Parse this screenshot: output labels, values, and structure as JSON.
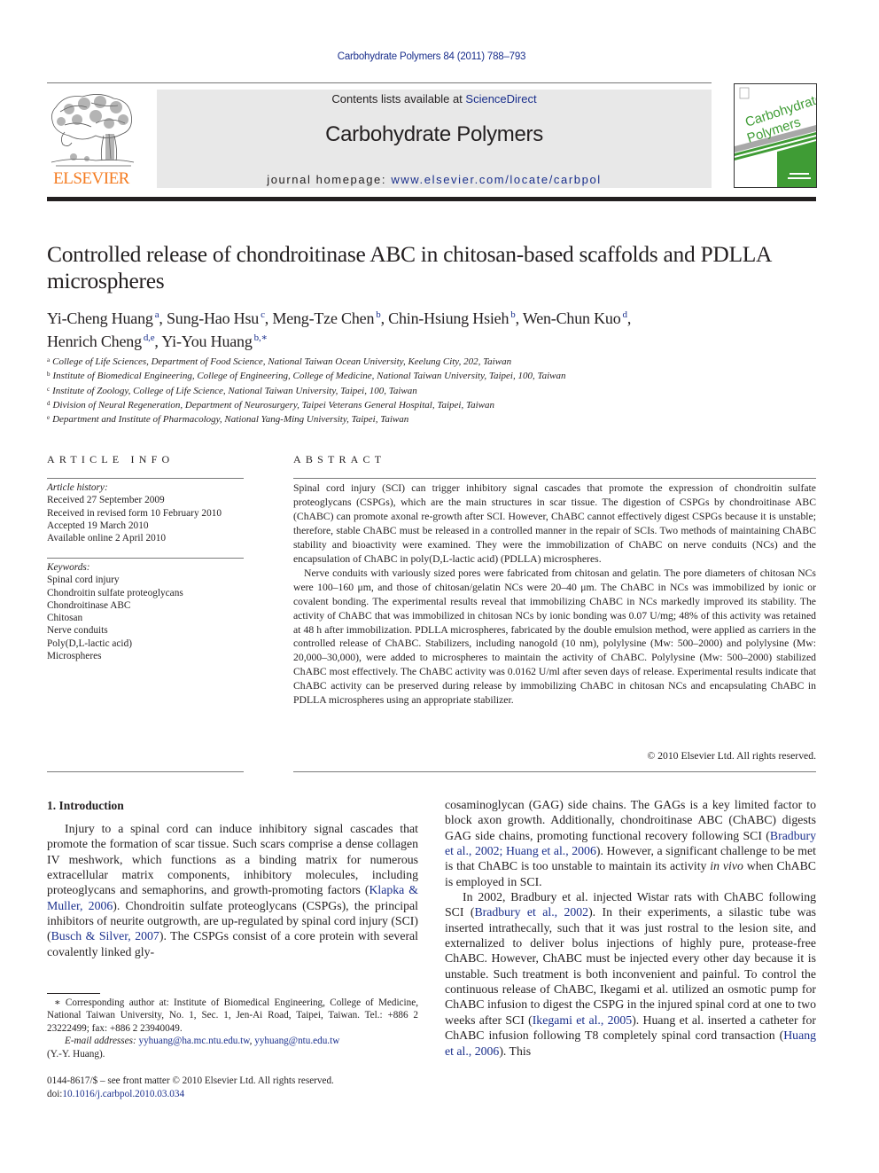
{
  "header": {
    "citation": "Carbohydrate Polymers 84 (2011) 788–793",
    "contents_prefix": "Contents lists available at ",
    "contents_link": "ScienceDirect",
    "journal_title": "Carbohydrate Polymers",
    "homepage_prefix": "journal homepage: ",
    "homepage_link": "www.elsevier.com/locate/carbpol",
    "publisher_logo_text": "ELSEVIER",
    "cover_title_line1": "Carbohydrate",
    "cover_title_line2": "Polymers",
    "colors": {
      "link": "#1a2f8c",
      "elsevier_orange": "#f47b20",
      "cover_green": "#3f9c35",
      "banner_bg": "#e8e8e8"
    }
  },
  "article": {
    "title": "Controlled release of chondroitinase ABC in chitosan-based scaffolds and PDLLA microspheres",
    "authors": [
      {
        "name": "Yi-Cheng Huang",
        "sup": "a"
      },
      {
        "name": "Sung-Hao Hsu",
        "sup": "c"
      },
      {
        "name": "Meng-Tze Chen",
        "sup": "b"
      },
      {
        "name": "Chin-Hsiung Hsieh",
        "sup": "b"
      },
      {
        "name": "Wen-Chun Kuo",
        "sup": "d"
      },
      {
        "name": "Henrich Cheng",
        "sup": "d,e"
      },
      {
        "name": "Yi-You Huang",
        "sup": "b,∗"
      }
    ],
    "affiliations": [
      {
        "key": "a",
        "text": "College of Life Sciences, Department of Food Science, National Taiwan Ocean University, Keelung City, 202, Taiwan"
      },
      {
        "key": "b",
        "text": "Institute of Biomedical Engineering, College of Engineering, College of Medicine, National Taiwan University, Taipei, 100, Taiwan"
      },
      {
        "key": "c",
        "text": "Institute of Zoology, College of Life Science, National Taiwan University, Taipei, 100, Taiwan"
      },
      {
        "key": "d",
        "text": "Division of Neural Regeneration, Department of Neurosurgery, Taipei Veterans General Hospital, Taipei, Taiwan"
      },
      {
        "key": "e",
        "text": "Department and Institute of Pharmacology, National Yang-Ming University, Taipei, Taiwan"
      }
    ]
  },
  "article_info": {
    "heading": "ARTICLE INFO",
    "history_label": "Article history:",
    "history": [
      "Received 27 September 2009",
      "Received in revised form 10 February 2010",
      "Accepted 19 March 2010",
      "Available online 2 April 2010"
    ],
    "keywords_label": "Keywords:",
    "keywords": [
      "Spinal cord injury",
      "Chondroitin sulfate proteoglycans",
      "Chondroitinase ABC",
      "Chitosan",
      "Nerve conduits",
      "Poly(D,L-lactic acid)",
      "Microspheres"
    ]
  },
  "abstract": {
    "heading": "ABSTRACT",
    "paragraphs": [
      "Spinal cord injury (SCI) can trigger inhibitory signal cascades that promote the expression of chondroitin sulfate proteoglycans (CSPGs), which are the main structures in scar tissue. The digestion of CSPGs by chondroitinase ABC (ChABC) can promote axonal re-growth after SCI. However, ChABC cannot effectively digest CSPGs because it is unstable; therefore, stable ChABC must be released in a controlled manner in the repair of SCIs. Two methods of maintaining ChABC stability and bioactivity were examined. They were the immobilization of ChABC on nerve conduits (NCs) and the encapsulation of ChABC in poly(D,L-lactic acid) (PDLLA) microspheres.",
      "Nerve conduits with variously sized pores were fabricated from chitosan and gelatin. The pore diameters of chitosan NCs were 100–160 μm, and those of chitosan/gelatin NCs were 20–40 μm. The ChABC in NCs was immobilized by ionic or covalent bonding. The experimental results reveal that immobilizing ChABC in NCs markedly improved its stability. The activity of ChABC that was immobilized in chitosan NCs by ionic bonding was 0.07 U/mg; 48% of this activity was retained at 48 h after immobilization. PDLLA microspheres, fabricated by the double emulsion method, were applied as carriers in the controlled release of ChABC. Stabilizers, including nanogold (10 nm), polylysine (Mw: 500–2000) and polylysine (Mw: 20,000–30,000), were added to microspheres to maintain the activity of ChABC. Polylysine (Mw: 500–2000) stabilized ChABC most effectively. The ChABC activity was 0.0162 U/ml after seven days of release. Experimental results indicate that ChABC activity can be preserved during release by immobilizing ChABC in chitosan NCs and encapsulating ChABC in PDLLA microspheres using an appropriate stabilizer."
    ],
    "copyright": "© 2010 Elsevier Ltd. All rights reserved."
  },
  "body": {
    "section_heading": "1.  Introduction",
    "col1": {
      "p1_a": "Injury to a spinal cord can induce inhibitory signal cascades that promote the formation of scar tissue. Such scars comprise a dense collagen IV meshwork, which functions as a binding matrix for numerous extracellular matrix components, inhibitory molecules, including proteoglycans and semaphorins, and growth-promoting factors (",
      "p1_ref1": "Klapka & Muller, 2006",
      "p1_b": "). Chondroitin sulfate proteoglycans (CSPGs), the principal inhibitors of neurite outgrowth, are up-regulated by spinal cord injury (SCI) (",
      "p1_ref2": "Busch & Silver, 2007",
      "p1_c": "). The CSPGs consist of a core protein with several covalently linked gly-"
    },
    "col2": {
      "p1_a": "cosaminoglycan (GAG) side chains. The GAGs is a key limited factor to block axon growth. Additionally, chondroitinase ABC (ChABC) digests GAG side chains, promoting functional recovery following SCI (",
      "p1_ref1": "Bradbury et al., 2002; Huang et al., 2006",
      "p1_b": "). However, a significant challenge to be met is that ChABC is too unstable to maintain its activity ",
      "p1_italic": "in vivo",
      "p1_c": " when ChABC is employed in SCI.",
      "p2_a": "In 2002, Bradbury et al. injected Wistar rats with ChABC following SCI (",
      "p2_ref1": "Bradbury et al., 2002",
      "p2_b": "). In their experiments, a silastic tube was inserted intrathecally, such that it was just rostral to the lesion site, and externalized to deliver bolus injections of highly pure, protease-free ChABC. However, ChABC must be injected every other day because it is unstable. Such treatment is both inconvenient and painful. To control the continuous release of ChABC, Ikegami et al. utilized an osmotic pump for ChABC infusion to digest the CSPG in the injured spinal cord at one to two weeks after SCI (",
      "p2_ref2": "Ikegami et al., 2005",
      "p2_c": "). Huang et al. inserted a catheter for ChABC infusion following T8 completely spinal cord transaction (",
      "p2_ref3": "Huang et al., 2006",
      "p2_d": "). This"
    }
  },
  "footnote": {
    "corresponding": "∗  Corresponding author at: Institute of Biomedical Engineering, College of Medicine, National Taiwan University, No. 1, Sec. 1, Jen-Ai Road, Taipei, Taiwan. Tel.: +886 2 23222499; fax: +886 2 23940049.",
    "email_label": "E-mail addresses:",
    "email1": "yyhuang@ha.mc.ntu.edu.tw",
    "email_sep": ", ",
    "email2": "yyhuang@ntu.edu.tw",
    "email_owner": "(Y.-Y. Huang).",
    "front_matter": "0144-8617/$ – see front matter © 2010 Elsevier Ltd. All rights reserved.",
    "doi_prefix": "doi:",
    "doi": "10.1016/j.carbpol.2010.03.034"
  }
}
